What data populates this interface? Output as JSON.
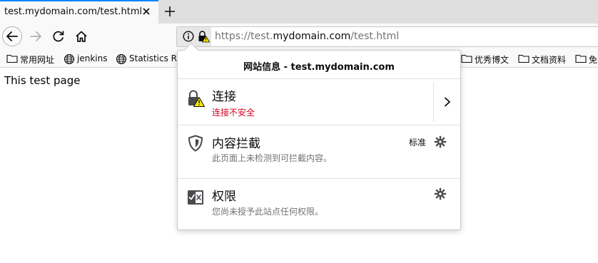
{
  "tab": {
    "title": "test.mydomain.com/test.html",
    "close_icon": "close-icon",
    "new_tab_icon": "plus-icon"
  },
  "navbar": {
    "back_icon": "arrow-left-icon",
    "forward_icon": "arrow-right-icon",
    "reload_icon": "reload-icon",
    "home_icon": "home-icon",
    "url": {
      "prefix": "https://test.",
      "host": "mydomain.com",
      "path": "/test.html"
    }
  },
  "bookmarks": [
    {
      "label": "常用网址",
      "icon": "folder-icon"
    },
    {
      "label": "jenkins",
      "icon": "globe-icon"
    },
    {
      "label": "Statistics Re",
      "icon": "globe-icon"
    },
    {
      "label": "优秀博文",
      "icon": "folder-icon"
    },
    {
      "label": "文档资料",
      "icon": "folder-icon"
    },
    {
      "label": "免",
      "icon": "folder-icon"
    }
  ],
  "page": {
    "text": "This test page"
  },
  "panel": {
    "title": "网站信息 - test.mydomain.com",
    "connection": {
      "title": "连接",
      "status": "连接不安全",
      "icon": "insecure-lock-icon"
    },
    "blocking": {
      "title": "内容拦截",
      "desc": "此页面上未检测到可拦截内容。",
      "level": "标准",
      "icon": "shield-icon"
    },
    "permissions": {
      "title": "权限",
      "desc": "您尚未授予此站点任何权限。",
      "icon": "permissions-icon"
    }
  },
  "colors": {
    "accent": "#0a84ff",
    "warning": "#d70022",
    "warning_badge": "#ffe900"
  }
}
